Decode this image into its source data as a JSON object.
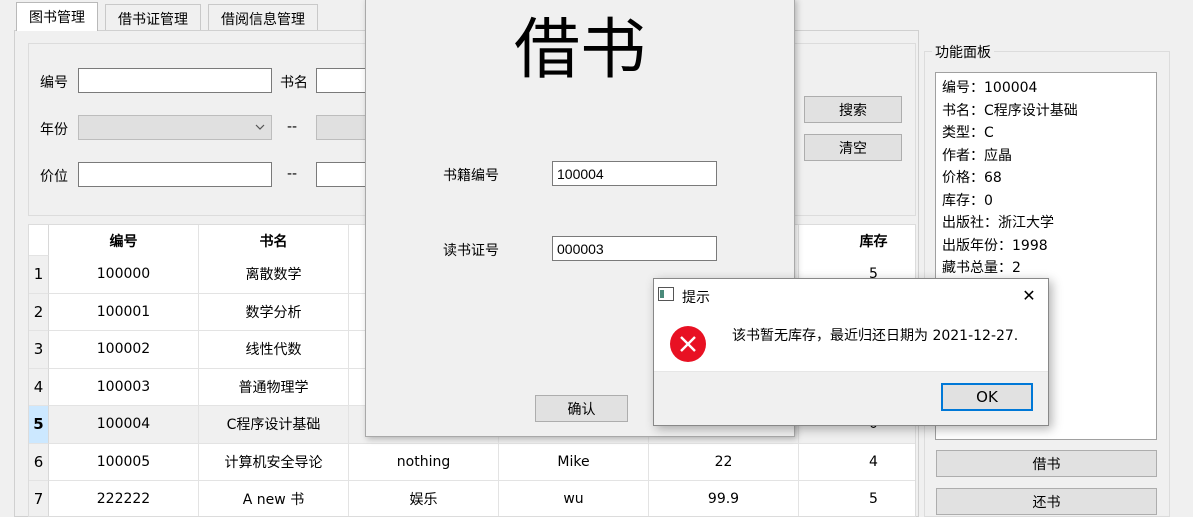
{
  "tabs": [
    {
      "label": "图书管理",
      "active": true
    },
    {
      "label": "借书证管理",
      "active": false
    },
    {
      "label": "借阅信息管理",
      "active": false
    }
  ],
  "search": {
    "id_label": "编号",
    "id_value": "",
    "name_label": "书名",
    "name_value": "",
    "year_label": "年份",
    "year_value": "",
    "range_sep": "--",
    "price_label": "价位",
    "price_min": "",
    "search_button": "搜索",
    "clear_button": "清空"
  },
  "table": {
    "headers": [
      "编号",
      "书名",
      "",
      "",
      "",
      "库存"
    ],
    "rows": [
      {
        "num": "1",
        "cells": [
          "100000",
          "离散数学",
          "",
          "",
          "",
          "5"
        ],
        "selected": false
      },
      {
        "num": "2",
        "cells": [
          "100001",
          "数学分析",
          "",
          "",
          "",
          ""
        ],
        "selected": false
      },
      {
        "num": "3",
        "cells": [
          "100002",
          "线性代数",
          "",
          "",
          "",
          ""
        ],
        "selected": false
      },
      {
        "num": "4",
        "cells": [
          "100003",
          "普通物理学",
          "",
          "",
          "",
          ""
        ],
        "selected": false
      },
      {
        "num": "5",
        "cells": [
          "100004",
          "C程序设计基础",
          "",
          "",
          "",
          "0"
        ],
        "selected": true
      },
      {
        "num": "6",
        "cells": [
          "100005",
          "计算机安全导论",
          "nothing",
          "Mike",
          "22",
          "4"
        ],
        "selected": false
      },
      {
        "num": "7",
        "cells": [
          "222222",
          "A new 书",
          "娱乐",
          "wu",
          "99.9",
          "5"
        ],
        "selected": false
      }
    ]
  },
  "panel": {
    "title": "功能面板",
    "info_lines": [
      "编号：100004",
      "书名：C程序设计基础",
      "类型：C",
      "作者：应晶",
      "价格：68",
      "库存：0",
      "出版社：浙江大学",
      "出版年份：1998",
      "藏书总量：2"
    ],
    "borrow_button": "借书",
    "return_button": "还书"
  },
  "borrow_dialog": {
    "heading": "借书",
    "book_id_label": "书籍编号",
    "book_id_value": "100004",
    "card_id_label": "读书证号",
    "card_id_value": "000003",
    "confirm_button": "确认"
  },
  "message_box": {
    "title": "提示",
    "message": "该书暂无库存，最近归还日期为 2021-12-27.",
    "ok_button": "OK",
    "close_symbol": "✕",
    "error_color": "#e81123"
  }
}
